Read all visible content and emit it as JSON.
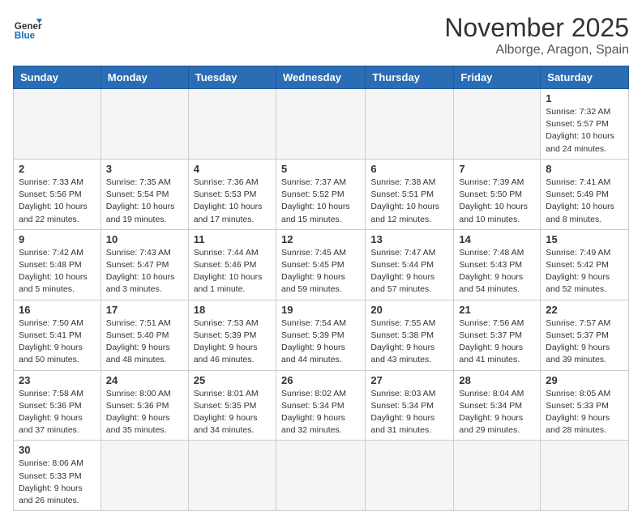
{
  "header": {
    "logo_general": "General",
    "logo_blue": "Blue",
    "month": "November 2025",
    "location": "Alborge, Aragon, Spain"
  },
  "days_of_week": [
    "Sunday",
    "Monday",
    "Tuesday",
    "Wednesday",
    "Thursday",
    "Friday",
    "Saturday"
  ],
  "weeks": [
    [
      {
        "day": "",
        "info": ""
      },
      {
        "day": "",
        "info": ""
      },
      {
        "day": "",
        "info": ""
      },
      {
        "day": "",
        "info": ""
      },
      {
        "day": "",
        "info": ""
      },
      {
        "day": "",
        "info": ""
      },
      {
        "day": "1",
        "info": "Sunrise: 7:32 AM\nSunset: 5:57 PM\nDaylight: 10 hours and 24 minutes."
      }
    ],
    [
      {
        "day": "2",
        "info": "Sunrise: 7:33 AM\nSunset: 5:56 PM\nDaylight: 10 hours and 22 minutes."
      },
      {
        "day": "3",
        "info": "Sunrise: 7:35 AM\nSunset: 5:54 PM\nDaylight: 10 hours and 19 minutes."
      },
      {
        "day": "4",
        "info": "Sunrise: 7:36 AM\nSunset: 5:53 PM\nDaylight: 10 hours and 17 minutes."
      },
      {
        "day": "5",
        "info": "Sunrise: 7:37 AM\nSunset: 5:52 PM\nDaylight: 10 hours and 15 minutes."
      },
      {
        "day": "6",
        "info": "Sunrise: 7:38 AM\nSunset: 5:51 PM\nDaylight: 10 hours and 12 minutes."
      },
      {
        "day": "7",
        "info": "Sunrise: 7:39 AM\nSunset: 5:50 PM\nDaylight: 10 hours and 10 minutes."
      },
      {
        "day": "8",
        "info": "Sunrise: 7:41 AM\nSunset: 5:49 PM\nDaylight: 10 hours and 8 minutes."
      }
    ],
    [
      {
        "day": "9",
        "info": "Sunrise: 7:42 AM\nSunset: 5:48 PM\nDaylight: 10 hours and 5 minutes."
      },
      {
        "day": "10",
        "info": "Sunrise: 7:43 AM\nSunset: 5:47 PM\nDaylight: 10 hours and 3 minutes."
      },
      {
        "day": "11",
        "info": "Sunrise: 7:44 AM\nSunset: 5:46 PM\nDaylight: 10 hours and 1 minute."
      },
      {
        "day": "12",
        "info": "Sunrise: 7:45 AM\nSunset: 5:45 PM\nDaylight: 9 hours and 59 minutes."
      },
      {
        "day": "13",
        "info": "Sunrise: 7:47 AM\nSunset: 5:44 PM\nDaylight: 9 hours and 57 minutes."
      },
      {
        "day": "14",
        "info": "Sunrise: 7:48 AM\nSunset: 5:43 PM\nDaylight: 9 hours and 54 minutes."
      },
      {
        "day": "15",
        "info": "Sunrise: 7:49 AM\nSunset: 5:42 PM\nDaylight: 9 hours and 52 minutes."
      }
    ],
    [
      {
        "day": "16",
        "info": "Sunrise: 7:50 AM\nSunset: 5:41 PM\nDaylight: 9 hours and 50 minutes."
      },
      {
        "day": "17",
        "info": "Sunrise: 7:51 AM\nSunset: 5:40 PM\nDaylight: 9 hours and 48 minutes."
      },
      {
        "day": "18",
        "info": "Sunrise: 7:53 AM\nSunset: 5:39 PM\nDaylight: 9 hours and 46 minutes."
      },
      {
        "day": "19",
        "info": "Sunrise: 7:54 AM\nSunset: 5:39 PM\nDaylight: 9 hours and 44 minutes."
      },
      {
        "day": "20",
        "info": "Sunrise: 7:55 AM\nSunset: 5:38 PM\nDaylight: 9 hours and 43 minutes."
      },
      {
        "day": "21",
        "info": "Sunrise: 7:56 AM\nSunset: 5:37 PM\nDaylight: 9 hours and 41 minutes."
      },
      {
        "day": "22",
        "info": "Sunrise: 7:57 AM\nSunset: 5:37 PM\nDaylight: 9 hours and 39 minutes."
      }
    ],
    [
      {
        "day": "23",
        "info": "Sunrise: 7:58 AM\nSunset: 5:36 PM\nDaylight: 9 hours and 37 minutes."
      },
      {
        "day": "24",
        "info": "Sunrise: 8:00 AM\nSunset: 5:36 PM\nDaylight: 9 hours and 35 minutes."
      },
      {
        "day": "25",
        "info": "Sunrise: 8:01 AM\nSunset: 5:35 PM\nDaylight: 9 hours and 34 minutes."
      },
      {
        "day": "26",
        "info": "Sunrise: 8:02 AM\nSunset: 5:34 PM\nDaylight: 9 hours and 32 minutes."
      },
      {
        "day": "27",
        "info": "Sunrise: 8:03 AM\nSunset: 5:34 PM\nDaylight: 9 hours and 31 minutes."
      },
      {
        "day": "28",
        "info": "Sunrise: 8:04 AM\nSunset: 5:34 PM\nDaylight: 9 hours and 29 minutes."
      },
      {
        "day": "29",
        "info": "Sunrise: 8:05 AM\nSunset: 5:33 PM\nDaylight: 9 hours and 28 minutes."
      }
    ],
    [
      {
        "day": "30",
        "info": "Sunrise: 8:06 AM\nSunset: 5:33 PM\nDaylight: 9 hours and 26 minutes."
      },
      {
        "day": "",
        "info": ""
      },
      {
        "day": "",
        "info": ""
      },
      {
        "day": "",
        "info": ""
      },
      {
        "day": "",
        "info": ""
      },
      {
        "day": "",
        "info": ""
      },
      {
        "day": "",
        "info": ""
      }
    ]
  ]
}
